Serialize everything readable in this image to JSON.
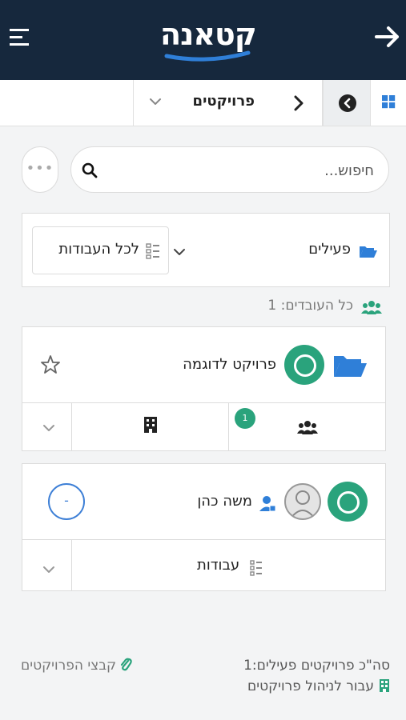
{
  "header": {
    "logo_text": "קטאנה",
    "back_icon": "arrow-right-icon",
    "menu_icon": "menu-icon"
  },
  "tabs": {
    "grid_icon": "grid-icon",
    "back_circle_icon": "circle-chevron-left-icon",
    "projects_label": "פרויקטים"
  },
  "search": {
    "placeholder": "חיפוש...",
    "more_label": "•••"
  },
  "filter": {
    "status_label": "פעילים",
    "all_jobs_label": "לכל העבודות"
  },
  "workers": {
    "label": "כל העובדים: 1"
  },
  "project_card": {
    "title": "פרויקט לדוגמה",
    "team_badge": "1"
  },
  "worker_card": {
    "name": "משה כהן",
    "status_ring": "-",
    "jobs_label": "עבודות"
  },
  "footer": {
    "active_projects": "סה\"כ פרויקטים פעילים:1",
    "manage_link": "עבור לניהול פרויקטים",
    "project_files": "קבצי הפרויקטים"
  },
  "colors": {
    "header_bg": "#16283d",
    "accent_green": "#2aa37c",
    "accent_blue": "#2f7fd8"
  }
}
